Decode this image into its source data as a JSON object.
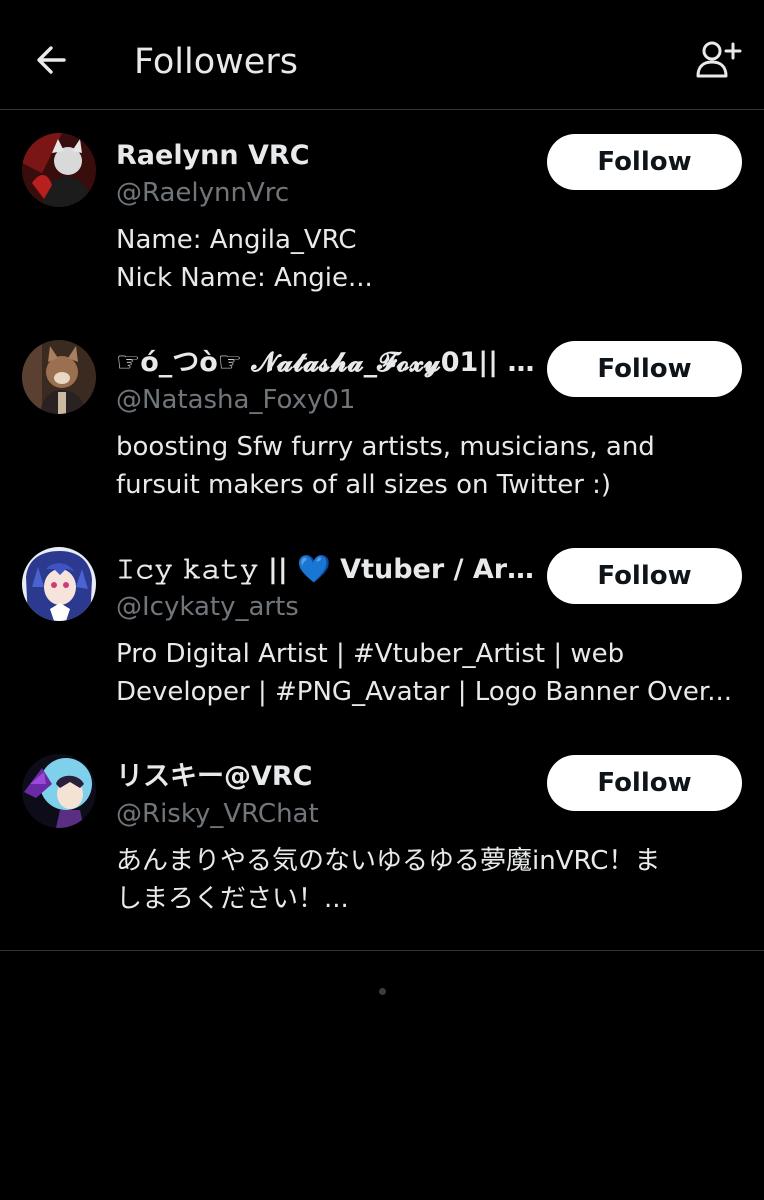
{
  "header": {
    "title": "Followers",
    "back_icon": "arrow-left-icon",
    "add_icon": "person-add-icon"
  },
  "colors": {
    "background": "#000000",
    "text": "#e7e9ea",
    "secondary_text": "#71767b",
    "button_bg": "#ffffff",
    "button_text": "#0f1419",
    "divider": "#2f3336"
  },
  "followers": [
    {
      "name": "Raelynn VRC",
      "handle": "@RaelynnVrc",
      "bio": [
        "Name: Angila_VRC",
        "Nick Name: Angie..."
      ],
      "button": "Follow"
    },
    {
      "name": "☞ó_つò☞ 𝓝𝓪𝓽𝓪𝓼𝓱𝓪_𝓕𝓸𝔁𝔂01|| ℂ...",
      "handle": "@Natasha_Foxy01",
      "bio": [
        "boosting Sfw furry artists, musicians, and",
        "fursuit makers of all sizes on Twitter :)"
      ],
      "button": "Follow"
    },
    {
      "name": "𝙸𝚌𝚢 𝚔𝚊𝚝𝚢 || 💙 Vtuber / Arti...",
      "handle": "@Icykaty_arts",
      "bio": [
        "Pro Digital Artist | #Vtuber_Artist | web",
        "Developer | #PNG_Avatar | Logo Banner Over..."
      ],
      "button": "Follow"
    },
    {
      "name": "リスキー@VRC",
      "handle": "@Risky_VRChat",
      "bio": [
        "あんまりやる気のないゆるゆる夢魔inVRC！ま",
        "しまろください！..."
      ],
      "button": "Follow"
    }
  ]
}
